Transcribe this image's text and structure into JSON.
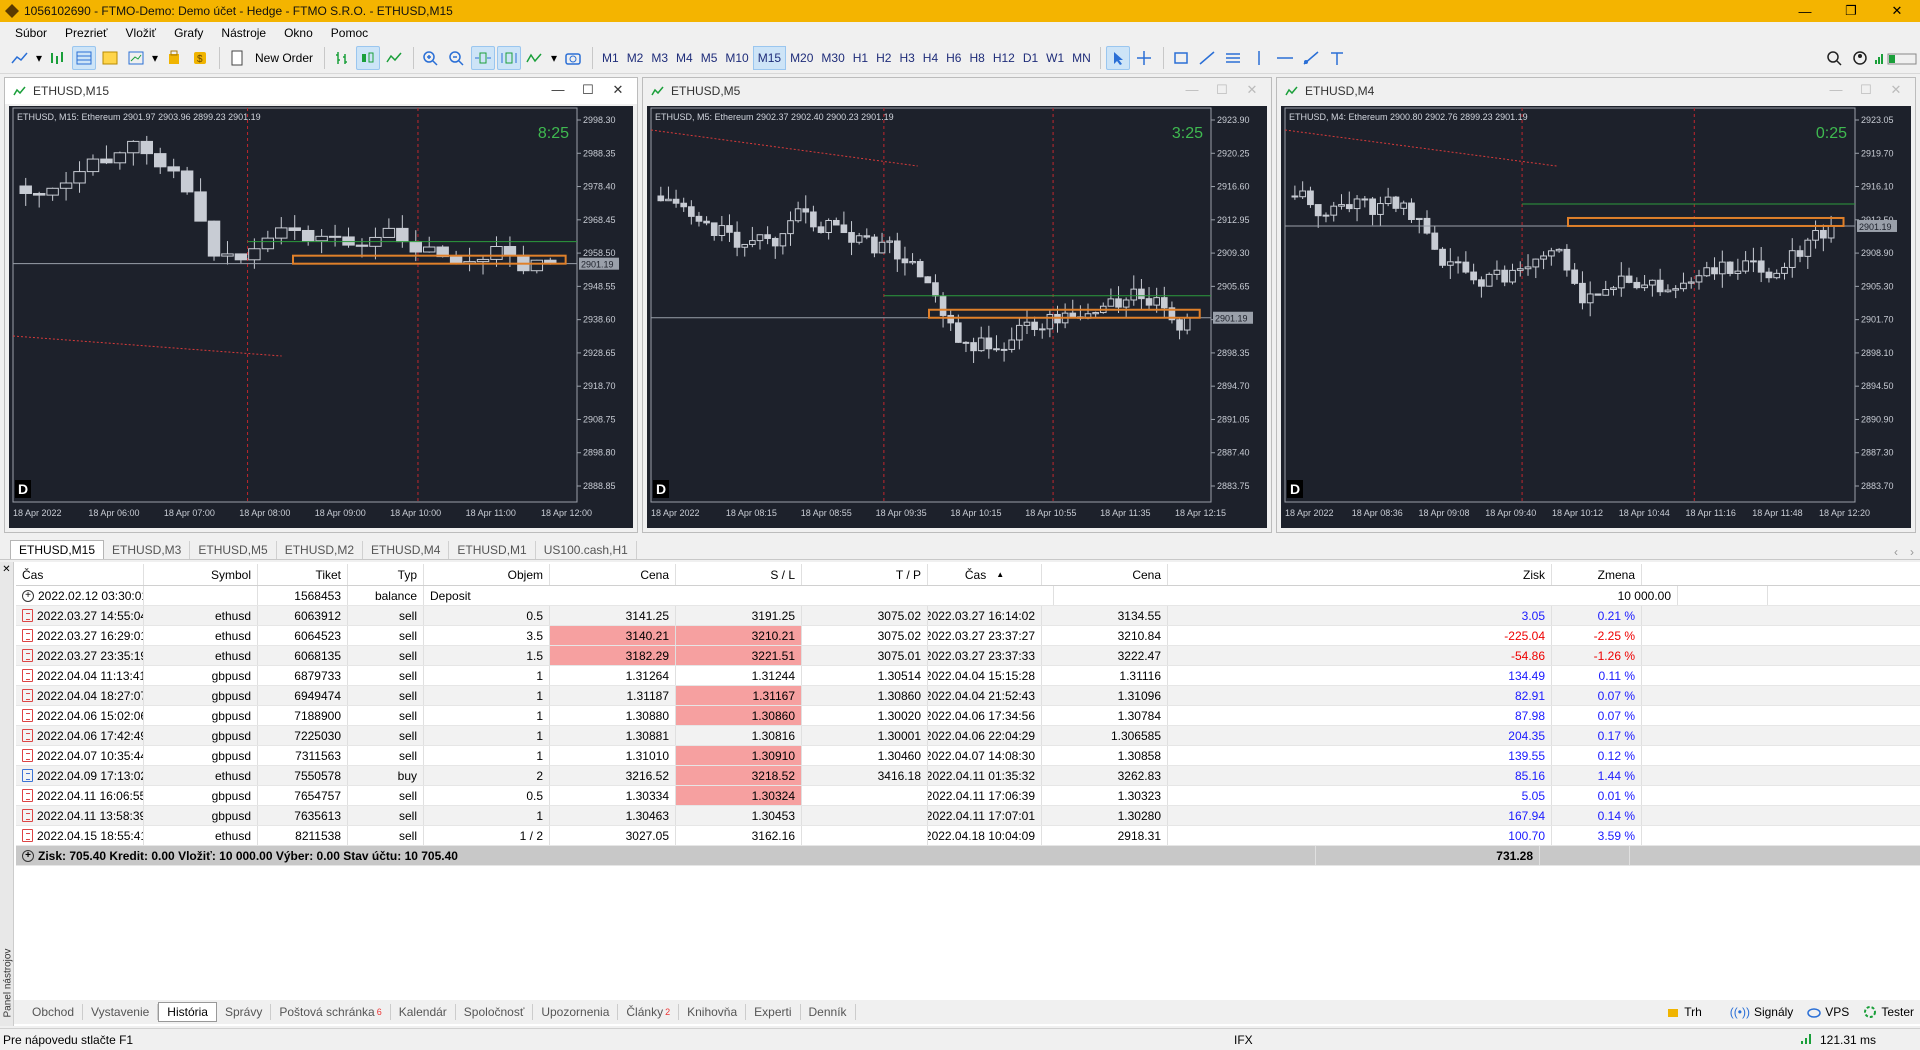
{
  "window": {
    "title": "1056102690 - FTMO-Demo: Demo účet - Hedge - FTMO S.R.O. - ETHUSD,M15"
  },
  "menu": [
    "Súbor",
    "Prezrieť",
    "Vložiť",
    "Grafy",
    "Nástroje",
    "Okno",
    "Pomoc"
  ],
  "toolbar": {
    "new_order": "New Order",
    "timeframes": [
      "M1",
      "M2",
      "M3",
      "M4",
      "M5",
      "M10",
      "M15",
      "M20",
      "M30",
      "H1",
      "H2",
      "H3",
      "H4",
      "H6",
      "H8",
      "H12",
      "D1",
      "W1",
      "MN"
    ],
    "active_timeframe": "M15"
  },
  "charts": [
    {
      "title": "ETHUSD,M15",
      "info": "ETHUSD, M15:  Ethereum  2901.97 2903.96 2899.23 2901.19",
      "timer": "8:25",
      "price_tag": "2901.19",
      "prices": [
        "2998.30",
        "2988.35",
        "2978.40",
        "2968.45",
        "2958.50",
        "2948.55",
        "2938.60",
        "2928.65",
        "2918.70",
        "2908.75",
        "2898.80",
        "2888.85"
      ],
      "times": [
        "18 Apr 2022",
        "18 Apr 06:00",
        "18 Apr 07:00",
        "18 Apr 08:00",
        "18 Apr 09:00",
        "18 Apr 10:00",
        "18 Apr 11:00",
        "18 Apr 12:00"
      ],
      "badge": "D"
    },
    {
      "title": "ETHUSD,M5",
      "info": "ETHUSD, M5:  Ethereum  2902.37 2902.40 2900.23 2901.19",
      "timer": "3:25",
      "price_tag": "2901.19",
      "prices": [
        "2923.90",
        "2920.25",
        "2916.60",
        "2912.95",
        "2909.30",
        "2905.65",
        "2902.00",
        "2898.35",
        "2894.70",
        "2891.05",
        "2887.40",
        "2883.75"
      ],
      "times": [
        "18 Apr 2022",
        "18 Apr 08:15",
        "18 Apr 08:55",
        "18 Apr 09:35",
        "18 Apr 10:15",
        "18 Apr 10:55",
        "18 Apr 11:35",
        "18 Apr 12:15"
      ],
      "badge": "D"
    },
    {
      "title": "ETHUSD,M4",
      "info": "ETHUSD, M4:  Ethereum  2900.80 2902.76 2899.23 2901.19",
      "timer": "0:25",
      "price_tag": "2901.19",
      "prices": [
        "2923.05",
        "2919.70",
        "2916.10",
        "2912.50",
        "2908.90",
        "2905.30",
        "2901.70",
        "2898.10",
        "2894.50",
        "2890.90",
        "2887.30",
        "2883.70"
      ],
      "times": [
        "18 Apr 2022",
        "18 Apr 08:36",
        "18 Apr 09:08",
        "18 Apr 09:40",
        "18 Apr 10:12",
        "18 Apr 10:44",
        "18 Apr 11:16",
        "18 Apr 11:48",
        "18 Apr 12:20"
      ],
      "badge": "D"
    }
  ],
  "symbol_tabs": [
    "ETHUSD,M15",
    "ETHUSD,M3",
    "ETHUSD,M5",
    "ETHUSD,M2",
    "ETHUSD,M4",
    "ETHUSD,M1",
    "US100.cash,H1"
  ],
  "history": {
    "headers": [
      "Čas",
      "Symbol",
      "Tiket",
      "Typ",
      "Objem",
      "Cena",
      "S / L",
      "T / P",
      "Čas",
      "Cena",
      "Zisk",
      "Zmena"
    ],
    "deposit": {
      "time": "2022.02.12 03:30:01",
      "ticket": "1568453",
      "type": "balance",
      "comment": "Deposit",
      "profit": "10 000.00"
    },
    "rows": [
      {
        "t1": "2022.03.27 14:55:04",
        "sym": "ethusd",
        "ticket": "6063912",
        "type": "sell",
        "vol": "0.5",
        "p1": "3141.25",
        "sl": "3191.25",
        "tp": "3075.02",
        "t2": "2022.03.27 16:14:02",
        "p2": "3134.55",
        "profit": "3.05",
        "chg": "0.21 %",
        "sl_hit": false,
        "neg": false
      },
      {
        "t1": "2022.03.27 16:29:01",
        "sym": "ethusd",
        "ticket": "6064523",
        "type": "sell",
        "vol": "3.5",
        "p1": "3140.21",
        "sl": "3210.21",
        "tp": "3075.02",
        "t2": "2022.03.27 23:37:27",
        "p2": "3210.84",
        "profit": "-225.04",
        "chg": "-2.25 %",
        "sl_hit": true,
        "neg": true
      },
      {
        "t1": "2022.03.27 23:35:19",
        "sym": "ethusd",
        "ticket": "6068135",
        "type": "sell",
        "vol": "1.5",
        "p1": "3182.29",
        "sl": "3221.51",
        "tp": "3075.01",
        "t2": "2022.03.27 23:37:33",
        "p2": "3222.47",
        "profit": "-54.86",
        "chg": "-1.26 %",
        "sl_hit": true,
        "neg": true
      },
      {
        "t1": "2022.04.04 11:13:41",
        "sym": "gbpusd",
        "ticket": "6879733",
        "type": "sell",
        "vol": "1",
        "p1": "1.31264",
        "sl": "1.31244",
        "tp": "1.30514",
        "t2": "2022.04.04 15:15:28",
        "p2": "1.31116",
        "profit": "134.49",
        "chg": "0.11 %",
        "sl_hit": false,
        "neg": false
      },
      {
        "t1": "2022.04.04 18:27:07",
        "sym": "gbpusd",
        "ticket": "6949474",
        "type": "sell",
        "vol": "1",
        "p1": "1.31187",
        "sl": "1.31167",
        "tp": "1.30860",
        "t2": "2022.04.04 21:52:43",
        "p2": "1.31096",
        "profit": "82.91",
        "chg": "0.07 %",
        "sl_hit": true,
        "neg": false
      },
      {
        "t1": "2022.04.06 15:02:06",
        "sym": "gbpusd",
        "ticket": "7188900",
        "type": "sell",
        "vol": "1",
        "p1": "1.30880",
        "sl": "1.30860",
        "tp": "1.30020",
        "t2": "2022.04.06 17:34:56",
        "p2": "1.30784",
        "profit": "87.98",
        "chg": "0.07 %",
        "sl_hit": true,
        "neg": false
      },
      {
        "t1": "2022.04.06 17:42:49",
        "sym": "gbpusd",
        "ticket": "7225030",
        "type": "sell",
        "vol": "1",
        "p1": "1.30881",
        "sl": "1.30816",
        "tp": "1.30001",
        "t2": "2022.04.06 22:04:29",
        "p2": "1.306585",
        "profit": "204.35",
        "chg": "0.17 %",
        "sl_hit": false,
        "neg": false
      },
      {
        "t1": "2022.04.07 10:35:44",
        "sym": "gbpusd",
        "ticket": "7311563",
        "type": "sell",
        "vol": "1",
        "p1": "1.31010",
        "sl": "1.30910",
        "tp": "1.30460",
        "t2": "2022.04.07 14:08:30",
        "p2": "1.30858",
        "profit": "139.55",
        "chg": "0.12 %",
        "sl_hit": true,
        "neg": false
      },
      {
        "t1": "2022.04.09 17:13:02",
        "sym": "ethusd",
        "ticket": "7550578",
        "type": "buy",
        "vol": "2",
        "p1": "3216.52",
        "sl": "3218.52",
        "tp": "3416.18",
        "t2": "2022.04.11 01:35:32",
        "p2": "3262.83",
        "profit": "85.16",
        "chg": "1.44 %",
        "sl_hit": true,
        "neg": false
      },
      {
        "t1": "2022.04.11 16:06:55",
        "sym": "gbpusd",
        "ticket": "7654757",
        "type": "sell",
        "vol": "0.5",
        "p1": "1.30334",
        "sl": "1.30324",
        "tp": "",
        "t2": "2022.04.11 17:06:39",
        "p2": "1.30323",
        "profit": "5.05",
        "chg": "0.01 %",
        "sl_hit": true,
        "neg": false
      },
      {
        "t1": "2022.04.11 13:58:39",
        "sym": "gbpusd",
        "ticket": "7635613",
        "type": "sell",
        "vol": "1",
        "p1": "1.30463",
        "sl": "1.30453",
        "tp": "",
        "t2": "2022.04.11 17:07:01",
        "p2": "1.30280",
        "profit": "167.94",
        "chg": "0.14 %",
        "sl_hit": false,
        "neg": false
      },
      {
        "t1": "2022.04.15 18:55:41",
        "sym": "ethusd",
        "ticket": "8211538",
        "type": "sell",
        "vol": "1 / 2",
        "p1": "3027.05",
        "sl": "3162.16",
        "tp": "",
        "t2": "2022.04.18 10:04:09",
        "p2": "2918.31",
        "profit": "100.70",
        "chg": "3.59 %",
        "sl_hit": false,
        "neg": false
      }
    ],
    "summary": "Zisk: 705.40  Kredit: 0.00  Vložiť: 10 000.00  Výber: 0.00  Stav účtu: 10 705.40",
    "summary_total": "731.28"
  },
  "side_panel_label": "Panel nástrojov",
  "bottom_tabs": [
    "Obchod",
    "Vystavenie",
    "História",
    "Správy",
    "Poštová schránka",
    "Kalendár",
    "Spoločnosť",
    "Upozornenia",
    "Články",
    "Knihovňa",
    "Experti",
    "Denník"
  ],
  "bottom_tab_badges": {
    "Poštová schránka": "6",
    "Články": "2"
  },
  "right_buttons": [
    "Trh",
    "Signály",
    "VPS",
    "Tester"
  ],
  "status": {
    "help": "Pre nápovedu stlačte F1",
    "server": "IFX",
    "ping": "121.31 ms"
  },
  "colors": {
    "titlebar": "#f4b400",
    "chart_bg": "#1d212b",
    "sl_hit": "#f6a0a0",
    "profit": "#1a1aff",
    "loss": "#ee0000"
  }
}
